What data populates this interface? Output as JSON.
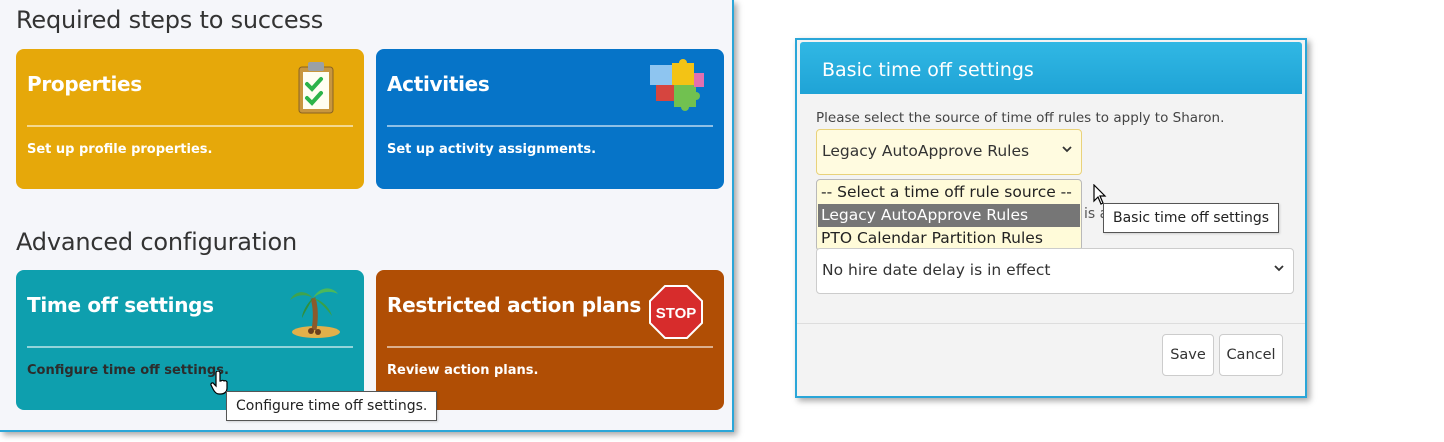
{
  "left": {
    "required_heading": "Required steps to success",
    "advanced_heading": "Advanced configuration",
    "cards": {
      "properties": {
        "title": "Properties",
        "description": "Set up profile properties.",
        "icon": "clipboard-check-icon",
        "color": "#e6a80a"
      },
      "activities": {
        "title": "Activities",
        "description": "Set up activity assignments.",
        "icon": "puzzle-icon",
        "color": "#0674c8"
      },
      "time_off": {
        "title": "Time off settings",
        "description": "Configure time off settings.",
        "icon": "palm-tree-icon",
        "color": "#0e9fae"
      },
      "restricted": {
        "title": "Restricted action plans",
        "description": "Review action plans.",
        "icon": "stop-sign-icon",
        "icon_text": "STOP",
        "color": "#b04e05"
      }
    },
    "tooltip": "Configure time off settings."
  },
  "dialog": {
    "title": "Basic time off settings",
    "prompt": "Please select the source of time off rules to apply to Sharon.",
    "rule_source_select": {
      "value": "Legacy AutoApprove Rules",
      "options": [
        "-- Select a time off rule source --",
        "Legacy AutoApprove Rules",
        "PTO Calendar Partition Rules"
      ],
      "selected_index": 1
    },
    "partial_text": "is a",
    "hire_date_select": {
      "value": "No hire date delay is in effect"
    },
    "save_label": "Save",
    "cancel_label": "Cancel",
    "tooltip": "Basic time off settings",
    "header_color": "#2aaee0"
  }
}
